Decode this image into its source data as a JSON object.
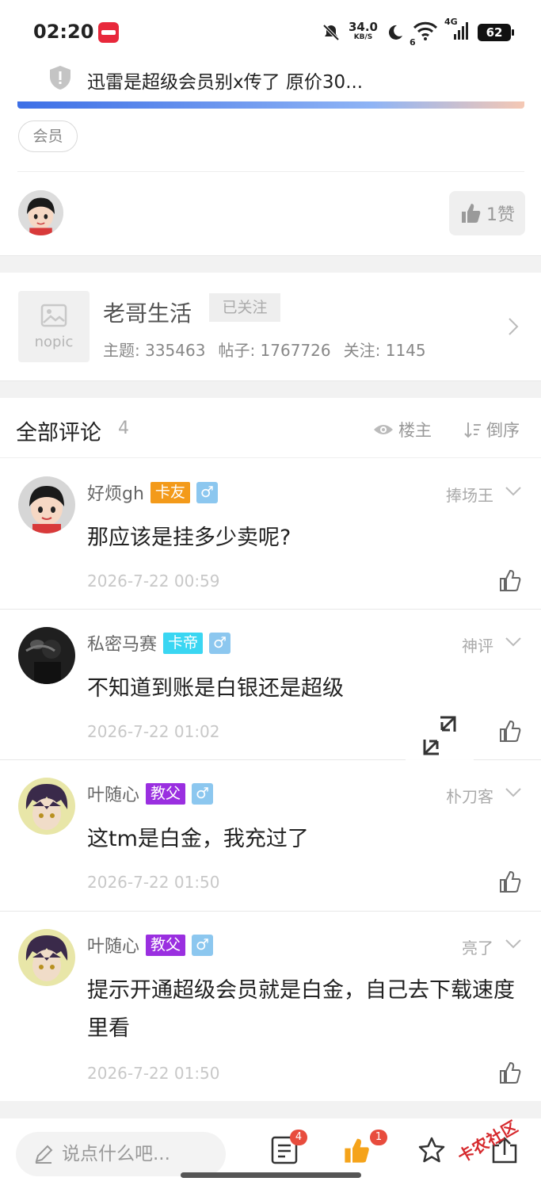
{
  "status_bar": {
    "time": "02:20",
    "net_speed": "34.0",
    "net_unit": "KB/S",
    "wifi_label": "6",
    "signal_label": "4G",
    "battery": "62"
  },
  "notice": {
    "text": "迅雷是超级会员别x传了 原价30..."
  },
  "post": {
    "tag": "会员",
    "like_label": "1赞"
  },
  "forum": {
    "image_placeholder": "nopic",
    "name": "老哥生活",
    "follow_status": "已关注",
    "stats": [
      "主题: 335463",
      "帖子: 1767726",
      "关注: 1145"
    ]
  },
  "comments_header": {
    "title": "全部评论",
    "count": "4",
    "filter_op": "楼主",
    "sort": "倒序"
  },
  "comments": [
    {
      "name": "好烦gh",
      "badge": "卡友",
      "badge_color": "#f39a1a",
      "gender": "♂",
      "rank": "捧场王",
      "text": "那应该是挂多少卖呢?",
      "time": "2026-7-22 00:59"
    },
    {
      "name": "私密马赛",
      "badge": "卡帝",
      "badge_color": "#3ad6f2",
      "gender": "♂",
      "rank": "神评",
      "text": "不知道到账是白银还是超级",
      "time": "2026-7-22 01:02"
    },
    {
      "name": "叶随心",
      "badge": "教父",
      "badge_color": "#9a2fe0",
      "gender": "♂",
      "rank": "朴刀客",
      "text": "这tm是白金，我充过了",
      "time": "2026-7-22 01:50"
    },
    {
      "name": "叶随心",
      "badge": "教父",
      "badge_color": "#9a2fe0",
      "gender": "♂",
      "rank": "亮了",
      "text": "提示开通超级会员就是白金，自己去下载速度里看",
      "time": "2026-7-22 01:50"
    }
  ],
  "bottom_bar": {
    "input_placeholder": "说点什么吧...",
    "comment_count": "4",
    "like_count": "1"
  },
  "watermark": {
    "text": "卡农社区"
  }
}
